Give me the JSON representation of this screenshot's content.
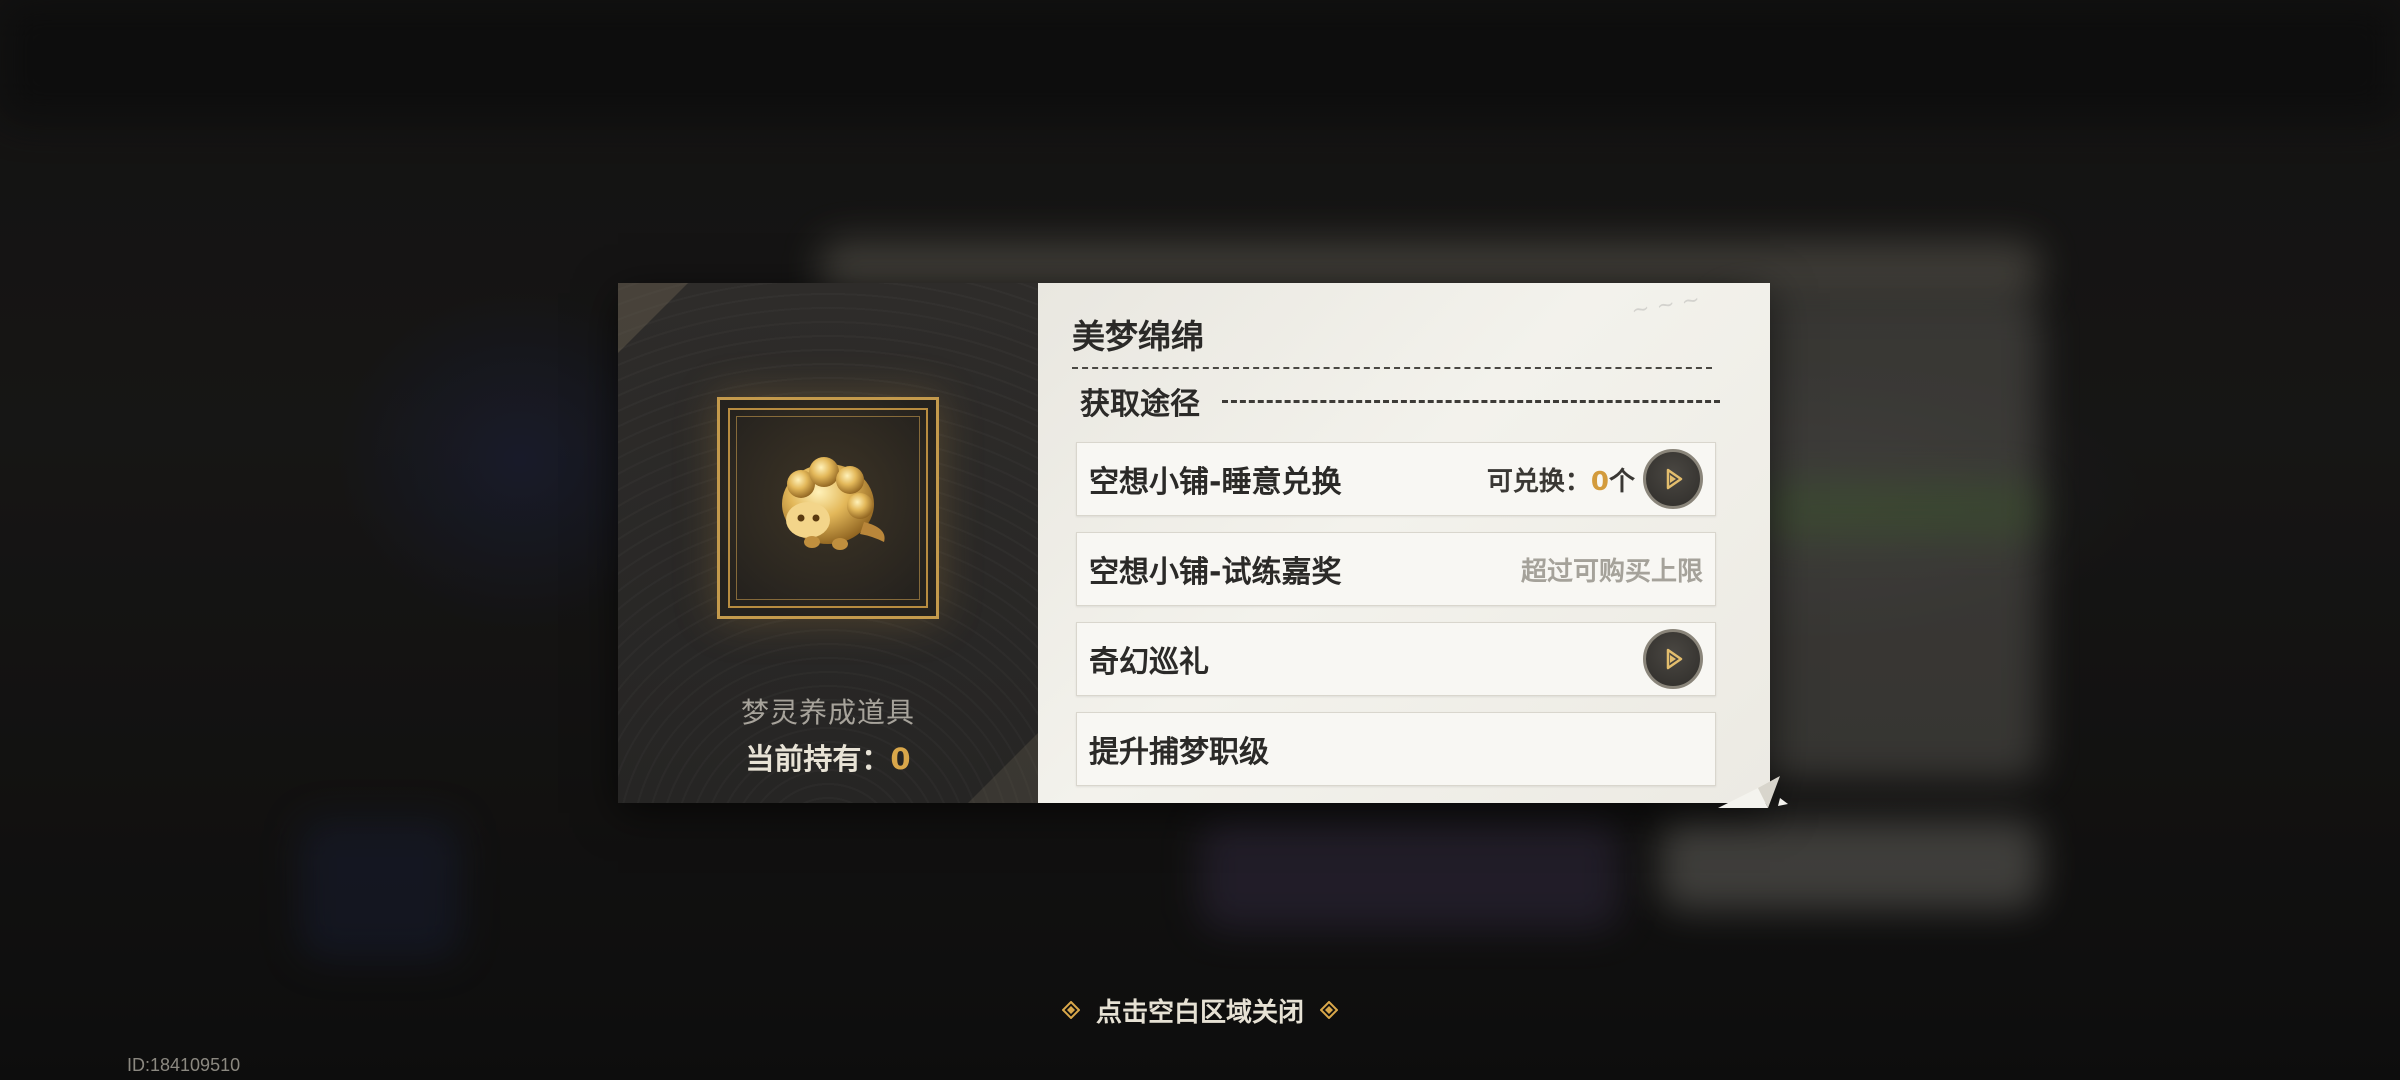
{
  "item": {
    "name": "美梦绵绵",
    "category": "梦灵养成道具",
    "holding_label": "当前持有：",
    "holding_value": "0",
    "icon": "golden-sheep-icon"
  },
  "sources": {
    "heading": "获取途径",
    "rows": [
      {
        "label": "空想小铺-睡意兑换",
        "exchange_label": "可兑换：",
        "exchange_value": "0",
        "exchange_unit": "个",
        "has_go": true
      },
      {
        "label": "空想小铺-试练嘉奖",
        "status": "超过可购买上限",
        "has_go": false
      },
      {
        "label": "奇幻巡礼",
        "has_go": true
      },
      {
        "label": "提升捕梦职级",
        "has_go": false
      }
    ]
  },
  "close_hint": "点击空白区域关闭",
  "uid": "ID:184109510",
  "colors": {
    "accent_gold": "#d9a74a",
    "panel_dark": "#2a2827",
    "panel_light": "#f0efe8"
  }
}
